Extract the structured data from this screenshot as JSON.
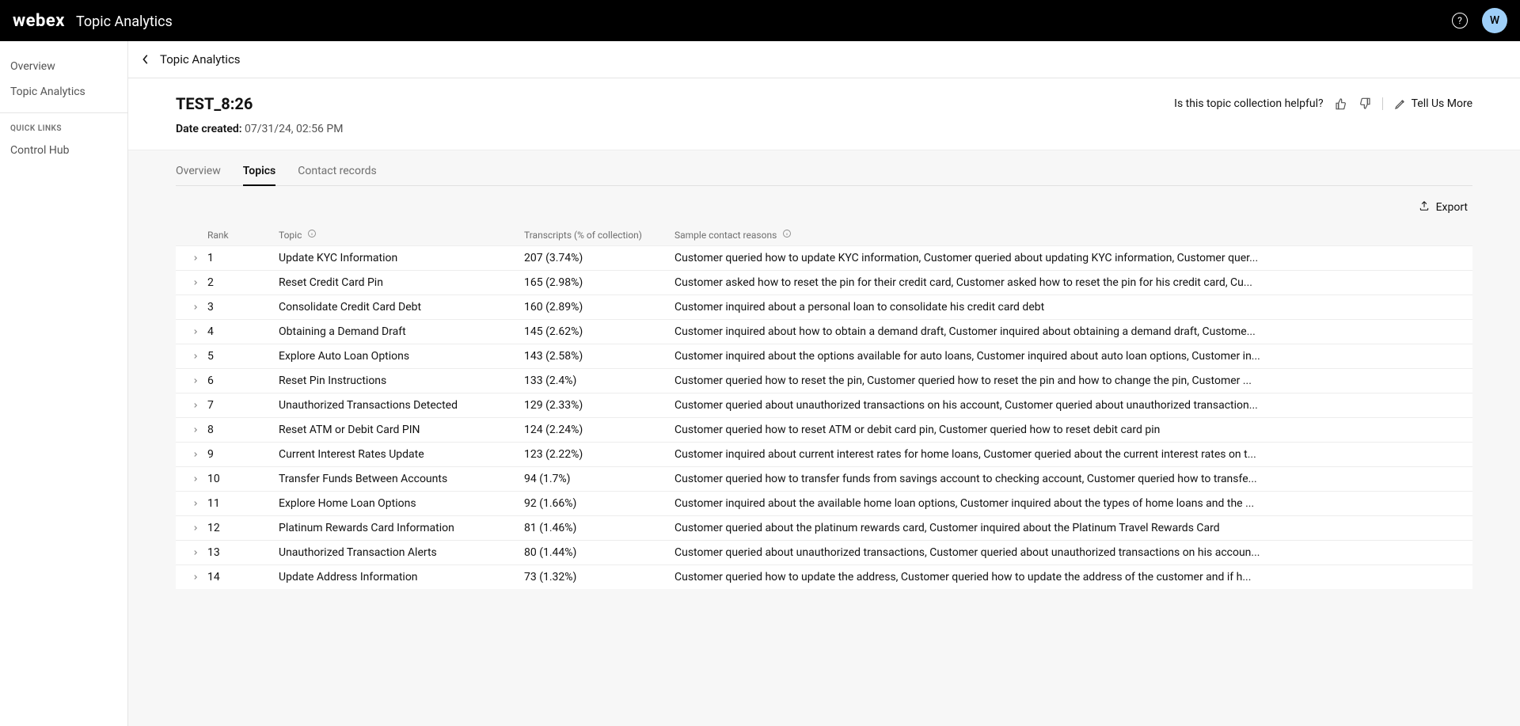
{
  "brand": {
    "logo": "webex",
    "title": "Topic Analytics"
  },
  "topbar": {
    "help_tooltip": "?",
    "avatar_initial": "W"
  },
  "sidebar": {
    "items": [
      {
        "label": "Overview"
      },
      {
        "label": "Topic Analytics"
      }
    ],
    "quick_links_heading": "QUICK LINKS",
    "quick_links": [
      {
        "label": "Control Hub"
      }
    ]
  },
  "breadcrumb": {
    "text": "Topic Analytics"
  },
  "header": {
    "title": "TEST_8:26",
    "date_label": "Date created:",
    "date_value": "07/31/24, 02:56 PM",
    "feedback_prompt": "Is this topic collection helpful?",
    "tell_more": "Tell Us More"
  },
  "tabs": [
    {
      "label": "Overview",
      "active": false
    },
    {
      "label": "Topics",
      "active": true
    },
    {
      "label": "Contact records",
      "active": false
    }
  ],
  "export_label": "Export",
  "table": {
    "columns": {
      "rank": "Rank",
      "topic": "Topic",
      "transcripts": "Transcripts (% of collection)",
      "sample": "Sample contact reasons"
    },
    "rows": [
      {
        "rank": "1",
        "topic": "Update KYC Information",
        "transcripts": "207 (3.74%)",
        "sample": "Customer queried how to update KYC information, Customer queried about updating KYC information, Customer quer..."
      },
      {
        "rank": "2",
        "topic": "Reset Credit Card Pin",
        "transcripts": "165 (2.98%)",
        "sample": "Customer asked how to reset the pin for their credit card, Customer asked how to reset the pin for his credit card, Cu..."
      },
      {
        "rank": "3",
        "topic": "Consolidate Credit Card Debt",
        "transcripts": "160 (2.89%)",
        "sample": "Customer inquired about a personal loan to consolidate his credit card debt"
      },
      {
        "rank": "4",
        "topic": "Obtaining a Demand Draft",
        "transcripts": "145 (2.62%)",
        "sample": "Customer inquired about how to obtain a demand draft, Customer inquired about obtaining a demand draft, Custome..."
      },
      {
        "rank": "5",
        "topic": "Explore Auto Loan Options",
        "transcripts": "143 (2.58%)",
        "sample": "Customer inquired about the options available for auto loans, Customer inquired about auto loan options, Customer in..."
      },
      {
        "rank": "6",
        "topic": "Reset Pin Instructions",
        "transcripts": "133 (2.4%)",
        "sample": "Customer queried how to reset the pin, Customer queried how to reset the pin and how to change the pin, Customer ..."
      },
      {
        "rank": "7",
        "topic": "Unauthorized Transactions Detected",
        "transcripts": "129 (2.33%)",
        "sample": "Customer queried about unauthorized transactions on his account, Customer queried about unauthorized transaction..."
      },
      {
        "rank": "8",
        "topic": "Reset ATM or Debit Card PIN",
        "transcripts": "124 (2.24%)",
        "sample": "Customer queried how to reset ATM or debit card pin, Customer queried how to reset debit card pin"
      },
      {
        "rank": "9",
        "topic": "Current Interest Rates Update",
        "transcripts": "123 (2.22%)",
        "sample": "Customer inquired about current interest rates for home loans, Customer queried about the current interest rates on t..."
      },
      {
        "rank": "10",
        "topic": "Transfer Funds Between Accounts",
        "transcripts": "94 (1.7%)",
        "sample": "Customer queried how to transfer funds from savings account to checking account, Customer queried how to transfe..."
      },
      {
        "rank": "11",
        "topic": "Explore Home Loan Options",
        "transcripts": "92 (1.66%)",
        "sample": "Customer inquired about the available home loan options, Customer inquired about the types of home loans and the ..."
      },
      {
        "rank": "12",
        "topic": "Platinum Rewards Card Information",
        "transcripts": "81 (1.46%)",
        "sample": "Customer queried about the platinum rewards card, Customer inquired about the Platinum Travel Rewards Card"
      },
      {
        "rank": "13",
        "topic": "Unauthorized Transaction Alerts",
        "transcripts": "80 (1.44%)",
        "sample": "Customer queried about unauthorized transactions, Customer queried about unauthorized transactions on his accoun..."
      },
      {
        "rank": "14",
        "topic": "Update Address Information",
        "transcripts": "73 (1.32%)",
        "sample": "Customer queried how to update the address, Customer queried how to update the address of the customer and if h..."
      }
    ]
  }
}
